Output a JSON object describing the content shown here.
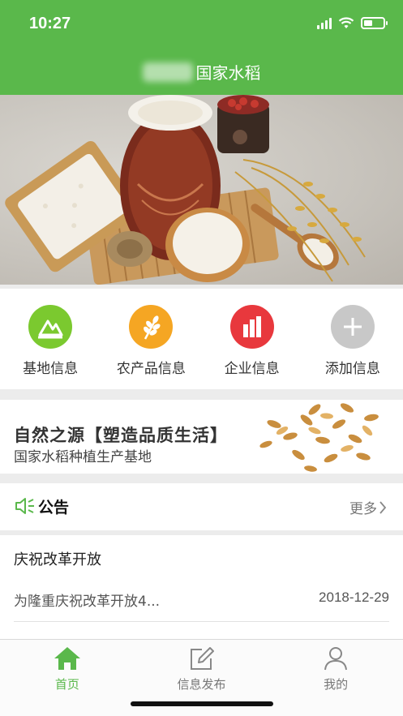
{
  "status_bar": {
    "time": "10:27"
  },
  "header": {
    "title": "国家水稻"
  },
  "grid": [
    {
      "label": "基地信息",
      "icon": "base-icon",
      "color": "#7bc92f"
    },
    {
      "label": "农产品信息",
      "icon": "wheat-icon",
      "color": "#f5a623"
    },
    {
      "label": "企业信息",
      "icon": "building-icon",
      "color": "#e8383d"
    },
    {
      "label": "添加信息",
      "icon": "plus-icon",
      "color": "#c8c8c8"
    }
  ],
  "promo": {
    "title": "自然之源【塑造品质生活】",
    "subtitle": "国家水稻种植生产基地"
  },
  "notice": {
    "title": "公告",
    "more": "更多",
    "item": {
      "title": "庆祝改革开放",
      "summary": "为隆重庆祝改革开放4...",
      "date": "2018-12-29"
    }
  },
  "tabs": [
    {
      "label": "首页",
      "icon": "home-icon",
      "active": true
    },
    {
      "label": "信息发布",
      "icon": "edit-icon",
      "active": false
    },
    {
      "label": "我的",
      "icon": "user-icon",
      "active": false
    }
  ],
  "colors": {
    "brand": "#5ab84b"
  }
}
